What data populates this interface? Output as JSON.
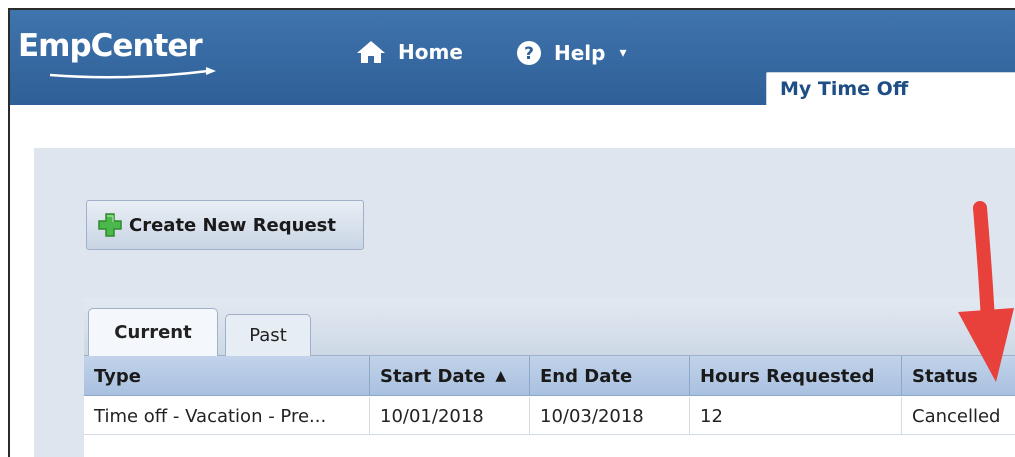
{
  "header": {
    "logo": "EmpCenter",
    "nav": [
      {
        "label": "Home",
        "icon": "home-icon"
      },
      {
        "label": "Help",
        "icon": "help-icon",
        "caret": "▾"
      }
    ],
    "page_tab": "My Time Off"
  },
  "toolbar": {
    "create_label": "Create New Request",
    "create_icon": "plus-icon"
  },
  "tabs": [
    {
      "label": "Current",
      "active": true
    },
    {
      "label": "Past",
      "active": false
    }
  ],
  "grid": {
    "columns": [
      "Type",
      "Start Date",
      "End Date",
      "Hours Requested",
      "Status"
    ],
    "sort_indicator": "▲",
    "rows": [
      {
        "type": "Time off - Vacation - Pre...",
        "start": "10/01/2018",
        "end": "10/03/2018",
        "hours": "12",
        "status": "Cancelled"
      }
    ]
  },
  "colors": {
    "header_blue": "#3f74ad",
    "annotation_red": "#e8403a",
    "plus_green": "#4cb84c"
  }
}
